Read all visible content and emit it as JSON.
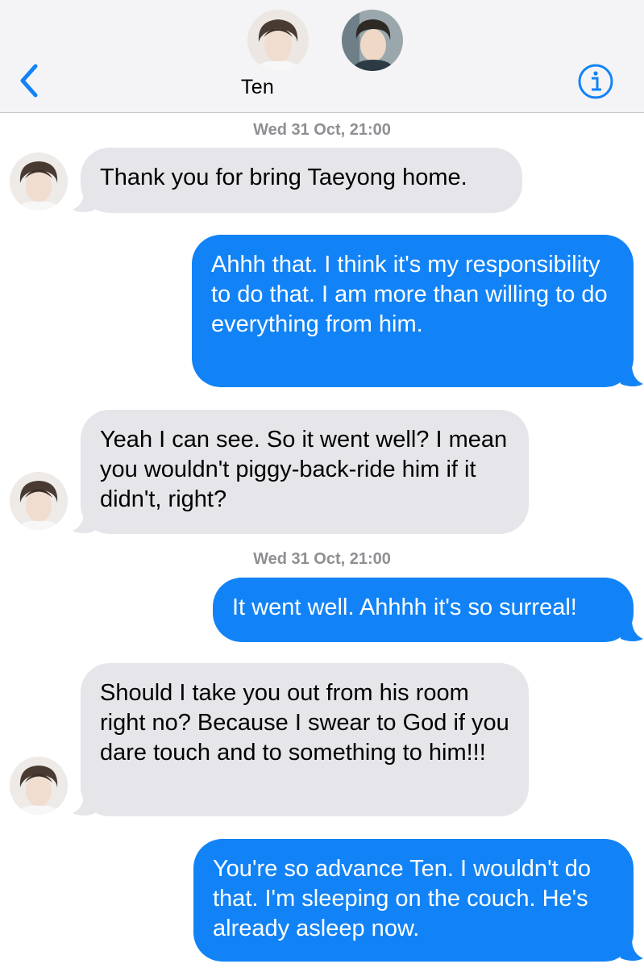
{
  "header": {
    "contact_name": "Ten",
    "back_icon": "chevron-left-icon",
    "info_icon": "info-circle-icon",
    "accent_color": "#1283f7"
  },
  "messages": [
    {
      "type": "timestamp",
      "text": "Wed 31 Oct, 21:00"
    },
    {
      "type": "incoming",
      "text": "Thank you for bring Taeyong home."
    },
    {
      "type": "outgoing",
      "text": "Ahhh that. I think it's my responsibility to do that. I am more than willing to do everything from him."
    },
    {
      "type": "incoming",
      "text": "Yeah I can see. So it went well? I mean you wouldn't piggy-back-ride him if it didn't, right?"
    },
    {
      "type": "timestamp",
      "text": "Wed 31 Oct, 21:00"
    },
    {
      "type": "outgoing",
      "text": "It went well. Ahhhh it's so surreal!"
    },
    {
      "type": "incoming",
      "text": "Should I take you out from his room right no? Because I swear to God if you dare touch and to something to him!!!"
    },
    {
      "type": "outgoing",
      "text": "You're so advance Ten. I wouldn't do that. I'm sleeping on the couch. He's already asleep now."
    }
  ],
  "colors": {
    "incoming_bubble": "#e5e5ea",
    "outgoing_bubble": "#1283f7",
    "timestamp": "#8e8e93"
  }
}
